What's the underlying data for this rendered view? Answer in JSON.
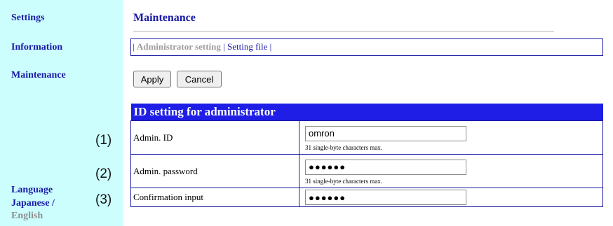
{
  "sidebar": {
    "settings": "Settings",
    "information": "Information",
    "maintenance": "Maintenance",
    "language_label": "Language",
    "japanese": "Japanese",
    "lang_sep": " /",
    "english": "English",
    "background_color": "#ccfefe"
  },
  "callouts": [
    "(1)",
    "(2)",
    "(3)"
  ],
  "page": {
    "title": "Maintenance"
  },
  "subnav": {
    "active": "Administrator setting",
    "link": "Setting file",
    "sep": "|"
  },
  "buttons": {
    "apply": "Apply",
    "cancel": "Cancel"
  },
  "admin_table": {
    "header": "ID setting for administrator",
    "header_color": "#1e1ee6",
    "rows": [
      {
        "label": "Admin. ID",
        "value": "omron",
        "hint": "31 single-byte characters max."
      },
      {
        "label": "Admin. password",
        "value": "●●●●●●",
        "hint": "31 single-byte characters max."
      },
      {
        "label": "Confirmation input",
        "value": "●●●●●●"
      }
    ]
  }
}
